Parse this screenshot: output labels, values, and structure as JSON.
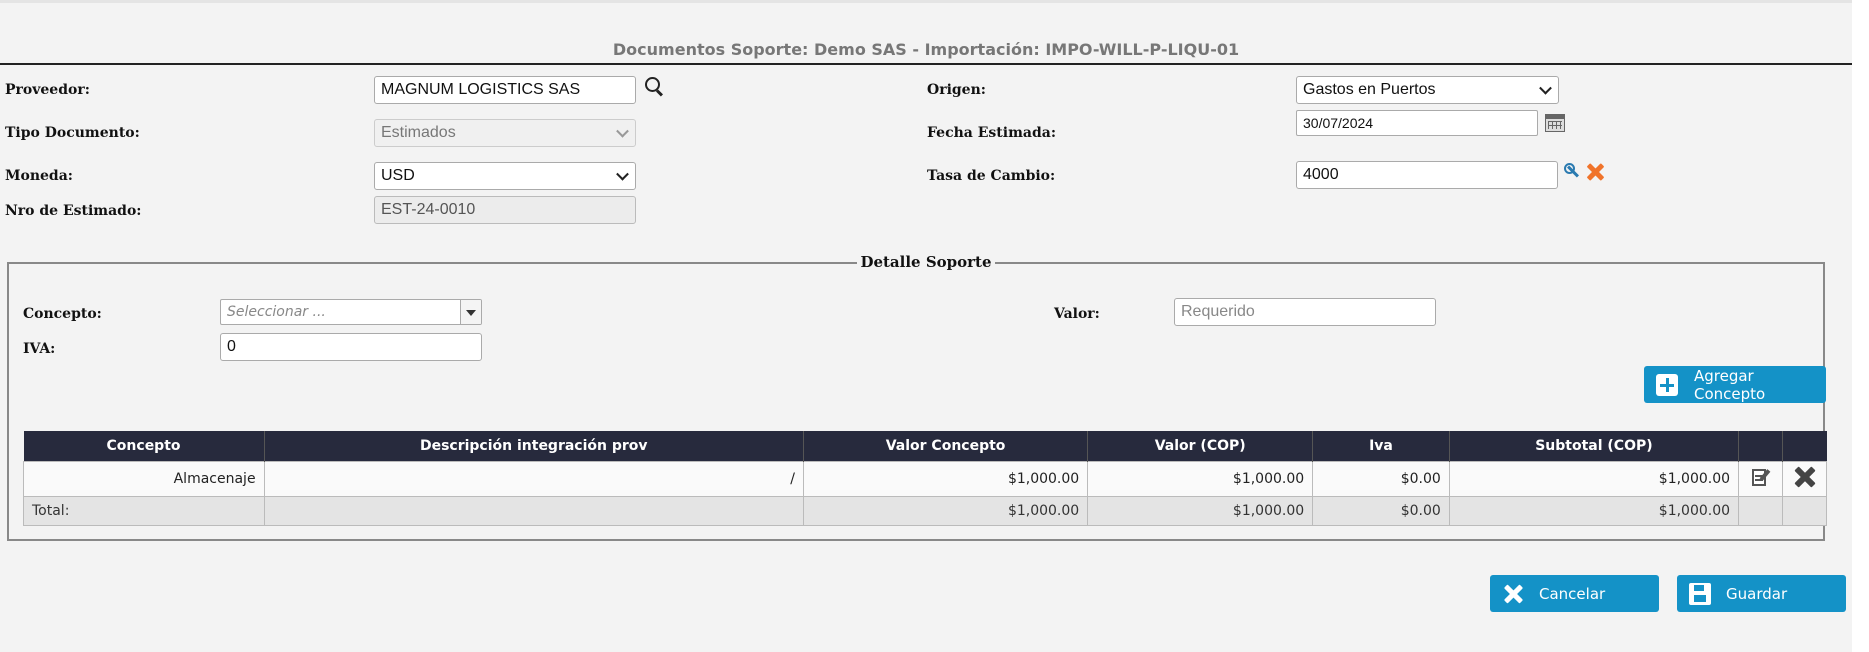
{
  "header": {
    "title": "Documentos Soporte: Demo SAS - Importación: IMPO-WILL-P-LIQU-01"
  },
  "form": {
    "proveedor": {
      "label": "Proveedor:",
      "value": "MAGNUM LOGISTICS SAS"
    },
    "tipo_documento": {
      "label": "Tipo Documento:",
      "value": "Estimados"
    },
    "moneda": {
      "label": "Moneda:",
      "value": "USD"
    },
    "nro_estimado": {
      "label": "Nro de Estimado:",
      "value": "EST-24-0010"
    },
    "origen": {
      "label": "Origen:",
      "value": "Gastos en Puertos"
    },
    "fecha_estimada": {
      "label": "Fecha Estimada:",
      "value": "30/07/2024"
    },
    "tasa_cambio": {
      "label": "Tasa de Cambio:",
      "value": "4000"
    }
  },
  "detalle": {
    "legend": "Detalle Soporte",
    "concepto": {
      "label": "Concepto:",
      "placeholder": "Seleccionar ..."
    },
    "iva": {
      "label": "IVA:",
      "value": "0"
    },
    "valor": {
      "label": "Valor:",
      "placeholder": "Requerido"
    },
    "add_button": "Agregar Concepto"
  },
  "table": {
    "headers": [
      "Concepto",
      "Descripción integración prov",
      "Valor Concepto",
      "Valor (COP)",
      "Iva",
      "Subtotal (COP)"
    ],
    "rows": [
      {
        "concepto": "Almacenaje",
        "descripcion": "/",
        "valor_concepto": "$1,000.00",
        "valor_cop": "$1,000.00",
        "iva": "$0.00",
        "subtotal": "$1,000.00"
      }
    ],
    "total": {
      "label": "Total:",
      "valor_concepto": "$1,000.00",
      "valor_cop": "$1,000.00",
      "iva": "$0.00",
      "subtotal": "$1,000.00"
    }
  },
  "actions": {
    "cancel": "Cancelar",
    "save": "Guardar"
  },
  "colors": {
    "accent": "#1492c7",
    "table_header": "#272a3d",
    "clear_icon": "#f0732a"
  }
}
